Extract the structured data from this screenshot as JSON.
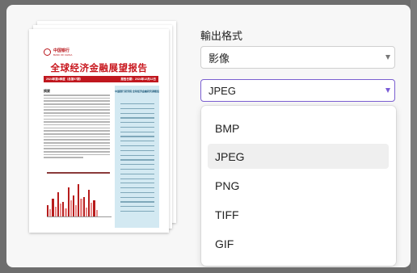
{
  "preview": {
    "logo_text": "中国银行",
    "logo_sub": "BANK OF CHINA",
    "title": "全球经济金融展望报告",
    "bar_left": "2024年第4季度（总第57期）",
    "bar_right": "报告日期：2024年12月12日",
    "section_head": "摘要",
    "side_header": "中国银行研究院 全球经济金融研究课题组"
  },
  "form": {
    "format_label": "輸出格式",
    "type_value": "影像",
    "format_value": "JPEG"
  },
  "menu": {
    "options": [
      "BMP",
      "JPEG",
      "PNG",
      "TIFF",
      "GIF"
    ],
    "selected": "JPEG"
  },
  "colors": {
    "accent": "#7b5fd0",
    "doc_red": "#c0171e",
    "side_panel": "#d3e9f2"
  }
}
